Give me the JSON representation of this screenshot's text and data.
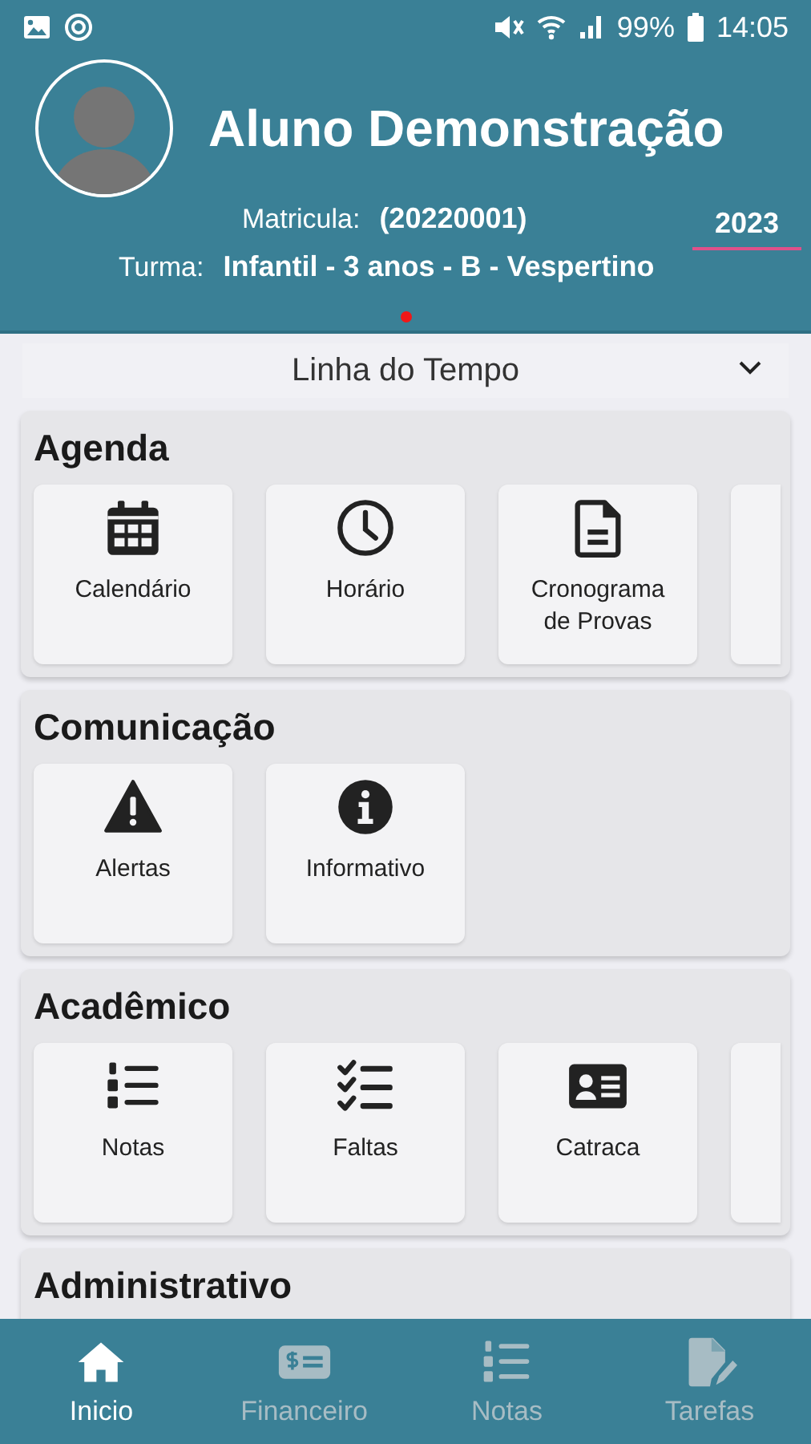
{
  "status_bar": {
    "battery_percent": "99%",
    "time": "14:05"
  },
  "profile": {
    "name": "Aluno Demonstração",
    "matricula_label": "Matricula:",
    "matricula": "(20220001)",
    "turma_label": "Turma:",
    "turma": "Infantil - 3 anos - B - Vespertino",
    "year": "2023"
  },
  "timeline": {
    "label": "Linha do Tempo",
    "expanded": false
  },
  "sections": [
    {
      "title": "Agenda",
      "more_cards": true,
      "items": [
        {
          "label": "Calendário",
          "kind": "calendar"
        },
        {
          "label": "Horário",
          "kind": "clock"
        },
        {
          "label": "Cronograma de Provas",
          "kind": "document"
        }
      ]
    },
    {
      "title": "Comunicação",
      "items": [
        {
          "label": "Alertas",
          "kind": "warning"
        },
        {
          "label": "Informativo",
          "kind": "info"
        }
      ]
    },
    {
      "title": "Acadêmico",
      "more_cards": true,
      "items": [
        {
          "label": "Notas",
          "kind": "numbered-list"
        },
        {
          "label": "Faltas",
          "kind": "checklist"
        },
        {
          "label": "Catraca",
          "kind": "id-card"
        }
      ]
    },
    {
      "title": "Administrativo"
    }
  ],
  "nav": [
    {
      "label": "Inicio",
      "kind": "home",
      "selected": true
    },
    {
      "label": "Financeiro",
      "kind": "money",
      "selected": false
    },
    {
      "label": "Notas",
      "kind": "numbered-list",
      "selected": false
    },
    {
      "label": "Tarefas",
      "kind": "edit-document",
      "selected": false
    }
  ]
}
